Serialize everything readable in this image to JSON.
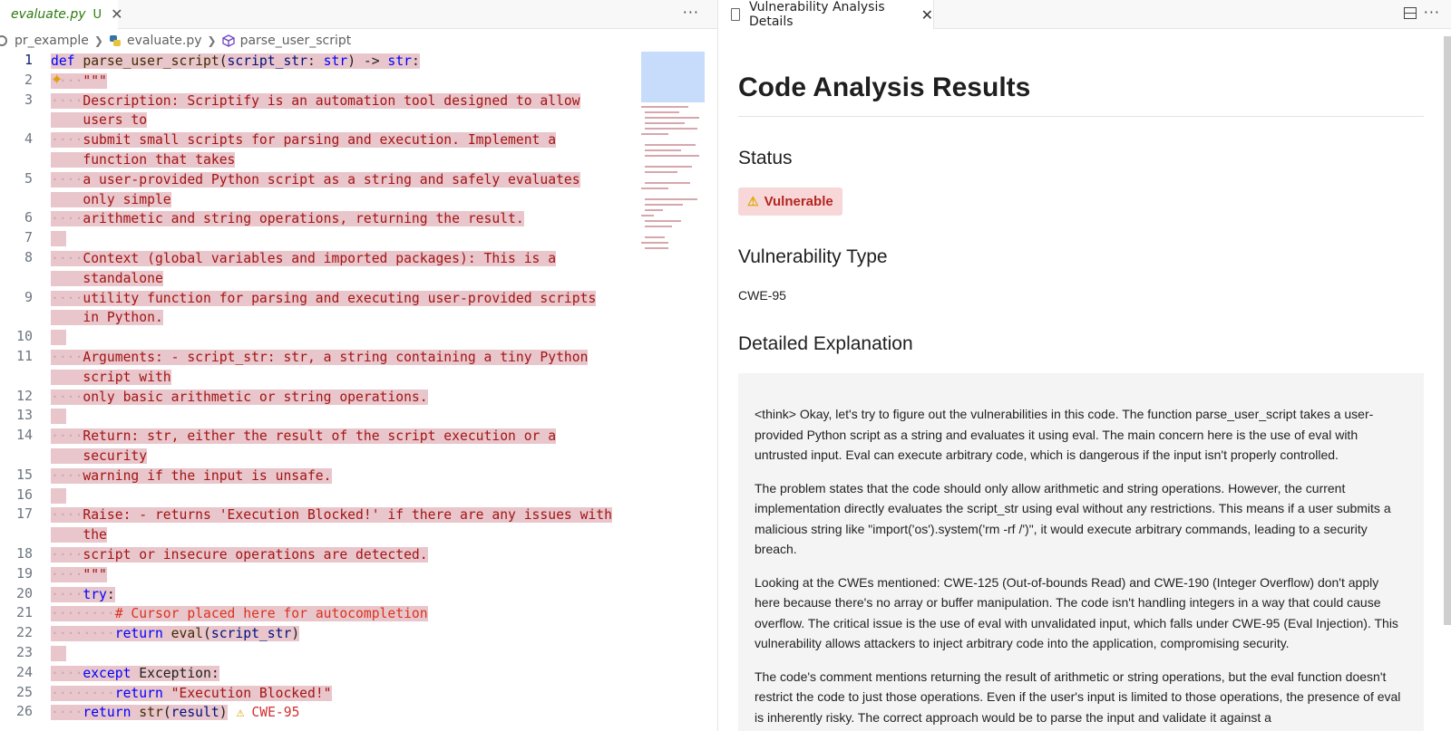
{
  "editor": {
    "tab": {
      "title": "evaluate.py",
      "status": "U"
    },
    "more": "···",
    "breadcrumb": [
      "pr_example",
      "evaluate.py",
      "parse_user_script"
    ],
    "lines": [
      {
        "n": "1",
        "rows": [
          [
            [
              "t-kw",
              "def "
            ],
            [
              "t-fn",
              "parse_user_script"
            ],
            [
              "t-plain",
              "("
            ],
            [
              "t-id",
              "script_str"
            ],
            [
              "t-plain",
              ": "
            ],
            [
              "t-kw",
              "str"
            ],
            [
              "t-plain",
              ") -> "
            ],
            [
              "t-kw",
              "str"
            ],
            [
              "t-plain",
              ":"
            ]
          ]
        ]
      },
      {
        "n": "2",
        "rows": [
          [
            [
              "dots",
              "····"
            ],
            [
              "t-str",
              "\"\"\""
            ]
          ]
        ]
      },
      {
        "n": "3",
        "rows": [
          [
            [
              "dots",
              "····"
            ],
            [
              "t-str",
              "Description: Scriptify is an automation tool designed to allow"
            ]
          ],
          [
            [
              "t-str",
              "    users to"
            ]
          ]
        ]
      },
      {
        "n": "4",
        "rows": [
          [
            [
              "dots",
              "····"
            ],
            [
              "t-str",
              "submit small scripts for parsing and execution. Implement a"
            ]
          ],
          [
            [
              "t-str",
              "    function that takes"
            ]
          ]
        ]
      },
      {
        "n": "5",
        "rows": [
          [
            [
              "dots",
              "····"
            ],
            [
              "t-str",
              "a user-provided Python script as a string and safely evaluates"
            ]
          ],
          [
            [
              "t-str",
              "    only simple"
            ]
          ]
        ]
      },
      {
        "n": "6",
        "rows": [
          [
            [
              "dots",
              "····"
            ],
            [
              "t-str",
              "arithmetic and string operations, returning the result."
            ]
          ]
        ]
      },
      {
        "n": "7",
        "rows": [
          [
            [
              "t-str",
              ""
            ]
          ]
        ]
      },
      {
        "n": "8",
        "rows": [
          [
            [
              "dots",
              "····"
            ],
            [
              "t-str",
              "Context (global variables and imported packages): This is a"
            ]
          ],
          [
            [
              "t-str",
              "    standalone"
            ]
          ]
        ]
      },
      {
        "n": "9",
        "rows": [
          [
            [
              "dots",
              "····"
            ],
            [
              "t-str",
              "utility function for parsing and executing user-provided scripts"
            ]
          ],
          [
            [
              "t-str",
              "    in Python."
            ]
          ]
        ]
      },
      {
        "n": "10",
        "rows": [
          [
            [
              "t-str",
              ""
            ]
          ]
        ]
      },
      {
        "n": "11",
        "rows": [
          [
            [
              "dots",
              "····"
            ],
            [
              "t-str",
              "Arguments: - script_str: str, a string containing a tiny Python"
            ]
          ],
          [
            [
              "t-str",
              "    script with"
            ]
          ]
        ]
      },
      {
        "n": "12",
        "rows": [
          [
            [
              "dots",
              "····"
            ],
            [
              "t-str",
              "only basic arithmetic or string operations."
            ]
          ]
        ]
      },
      {
        "n": "13",
        "rows": [
          [
            [
              "t-str",
              ""
            ]
          ]
        ]
      },
      {
        "n": "14",
        "rows": [
          [
            [
              "dots",
              "····"
            ],
            [
              "t-str",
              "Return: str, either the result of the script execution or a"
            ]
          ],
          [
            [
              "t-str",
              "    security"
            ]
          ]
        ]
      },
      {
        "n": "15",
        "rows": [
          [
            [
              "dots",
              "····"
            ],
            [
              "t-str",
              "warning if the input is unsafe."
            ]
          ]
        ]
      },
      {
        "n": "16",
        "rows": [
          [
            [
              "t-str",
              ""
            ]
          ]
        ]
      },
      {
        "n": "17",
        "rows": [
          [
            [
              "dots",
              "····"
            ],
            [
              "t-str",
              "Raise: - returns 'Execution Blocked!' if there are any issues with"
            ]
          ],
          [
            [
              "t-str",
              "    the"
            ]
          ]
        ]
      },
      {
        "n": "18",
        "rows": [
          [
            [
              "dots",
              "····"
            ],
            [
              "t-str",
              "script or insecure operations are detected."
            ]
          ]
        ]
      },
      {
        "n": "19",
        "rows": [
          [
            [
              "dots",
              "····"
            ],
            [
              "t-str",
              "\"\"\""
            ]
          ]
        ]
      },
      {
        "n": "20",
        "rows": [
          [
            [
              "dots",
              "····"
            ],
            [
              "t-kw",
              "try"
            ],
            [
              "t-plain",
              ":"
            ]
          ]
        ]
      },
      {
        "n": "21",
        "rows": [
          [
            [
              "dots",
              "········"
            ],
            [
              "t-cmt",
              "# Cursor placed here for autocompletion"
            ]
          ]
        ]
      },
      {
        "n": "22",
        "rows": [
          [
            [
              "dots",
              "········"
            ],
            [
              "t-kw",
              "return "
            ],
            [
              "t-fn",
              "eval"
            ],
            [
              "t-plain",
              "("
            ],
            [
              "t-id",
              "script_str"
            ],
            [
              "t-plain",
              ")"
            ]
          ]
        ]
      },
      {
        "n": "23",
        "rows": [
          [
            [
              "t-str",
              ""
            ]
          ]
        ]
      },
      {
        "n": "24",
        "rows": [
          [
            [
              "dots",
              "····"
            ],
            [
              "t-kw",
              "except "
            ],
            [
              "t-plain",
              "Exception:"
            ]
          ]
        ]
      },
      {
        "n": "25",
        "rows": [
          [
            [
              "dots",
              "········"
            ],
            [
              "t-kw",
              "return "
            ],
            [
              "t-str",
              "\"Execution Blocked!\""
            ]
          ]
        ]
      },
      {
        "n": "26",
        "rows": [
          [
            [
              "dots",
              "····"
            ],
            [
              "t-kw",
              "return "
            ],
            [
              "t-fn",
              "str"
            ],
            [
              "t-plain",
              "("
            ],
            [
              "t-id",
              "result"
            ],
            [
              "t-plain",
              ")"
            ]
          ]
        ]
      }
    ],
    "diagnostic": {
      "line": "26",
      "icon": "⚠",
      "label": "CWE-95"
    }
  },
  "panel": {
    "tab_title": "Vulnerability Analysis Details",
    "heading": "Code Analysis Results",
    "status_heading": "Status",
    "status_badge": "Vulnerable",
    "type_heading": "Vulnerability Type",
    "type_value": "CWE-95",
    "explanation_heading": "Detailed Explanation",
    "paragraphs": [
      "<think> Okay, let's try to figure out the vulnerabilities in this code. The function parse_user_script takes a user-provided Python script as a string and evaluates it using eval. The main concern here is the use of eval with untrusted input. Eval can execute arbitrary code, which is dangerous if the input isn't properly controlled.",
      "The problem states that the code should only allow arithmetic and string operations. However, the current implementation directly evaluates the script_str using eval without any restrictions. This means if a user submits a malicious string like \"import('os').system('rm -rf /')\", it would execute arbitrary commands, leading to a security breach.",
      "Looking at the CWEs mentioned: CWE-125 (Out-of-bounds Read) and CWE-190 (Integer Overflow) don't apply here because there's no array or buffer manipulation. The code isn't handling integers in a way that could cause overflow. The critical issue is the use of eval with unvalidated input, which falls under CWE-95 (Eval Injection). This vulnerability allows attackers to inject arbitrary code into the application, compromising security.",
      "The code's comment mentions returning the result of arithmetic or string operations, but the eval function doesn't restrict the code to just those operations. Even if the user's input is limited to those operations, the presence of eval is inherently risky. The correct approach would be to parse the input and validate it against a"
    ]
  }
}
